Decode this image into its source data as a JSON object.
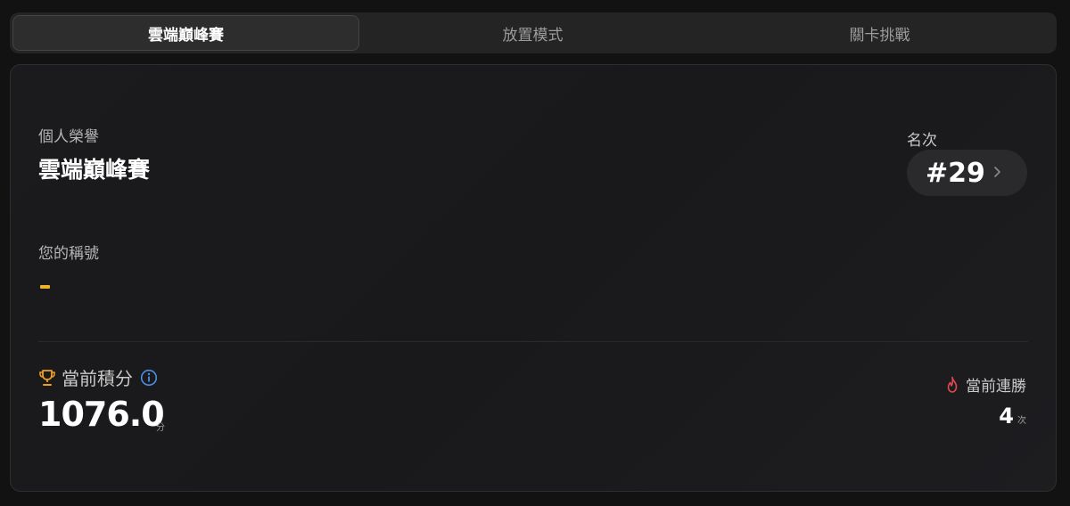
{
  "tabs": [
    {
      "label": "雲端巔峰賽",
      "active": true
    },
    {
      "label": "放置模式",
      "active": false
    },
    {
      "label": "關卡挑戰",
      "active": false
    }
  ],
  "honor": {
    "label": "個人榮譽",
    "value": "雲端巔峰賽"
  },
  "rank": {
    "label": "名次",
    "value": "#29",
    "icon": "chevron-right-icon"
  },
  "title": {
    "label": "您的稱號",
    "value": "-"
  },
  "score": {
    "label": "當前積分",
    "value": "1076.0",
    "unit": "分",
    "icon": "trophy-icon",
    "info_icon": "info-icon"
  },
  "streak": {
    "label": "當前連勝",
    "value": "4",
    "unit": "次",
    "icon": "flame-icon"
  },
  "colors": {
    "accent_yellow": "#f0b429",
    "trophy": "#f0a020",
    "info": "#4a90e2",
    "flame": "#e5484d"
  }
}
